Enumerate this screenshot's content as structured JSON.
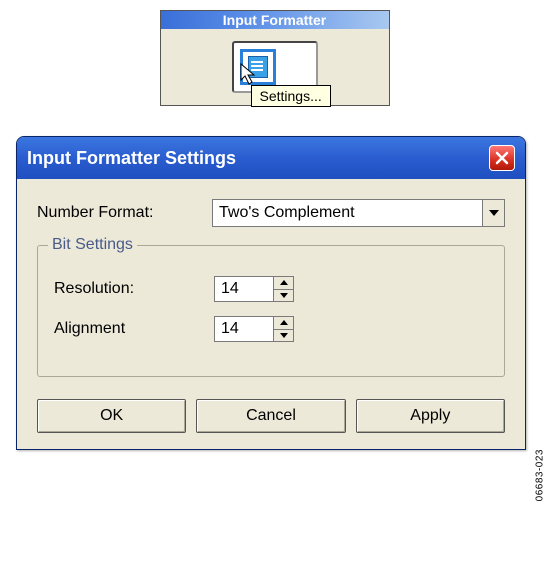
{
  "top": {
    "title": "Input Formatter",
    "tooltip": "Settings..."
  },
  "dialog": {
    "title": "Input Formatter Settings",
    "numberFormat": {
      "label": "Number Format:",
      "value": "Two's Complement"
    },
    "bitSettings": {
      "legend": "Bit Settings",
      "resolution": {
        "label": "Resolution:",
        "value": "14"
      },
      "alignment": {
        "label": "Alignment",
        "value": "14"
      }
    },
    "buttons": {
      "ok": "OK",
      "cancel": "Cancel",
      "apply": "Apply"
    }
  },
  "ref": "06683-023"
}
